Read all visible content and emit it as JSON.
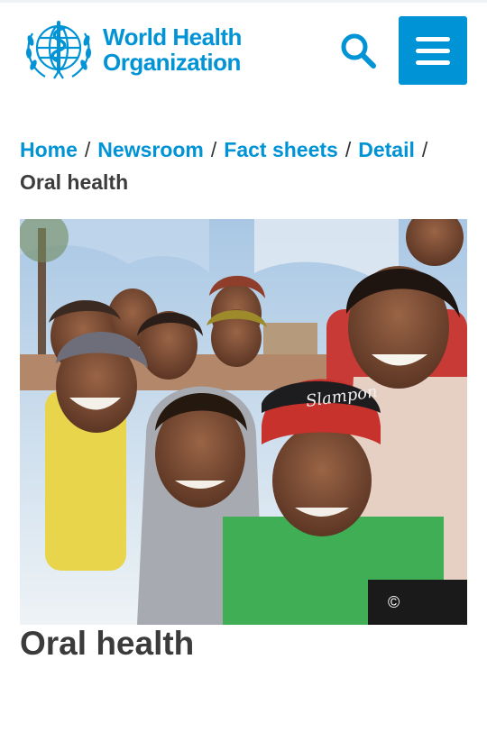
{
  "header": {
    "logo": {
      "line1": "World Health",
      "line2": "Organization"
    },
    "search_icon": "search-icon",
    "menu_icon": "hamburger-menu-icon"
  },
  "breadcrumb": {
    "items": [
      {
        "label": "Home"
      },
      {
        "label": "Newsroom"
      },
      {
        "label": "Fact sheets"
      },
      {
        "label": "Detail"
      }
    ],
    "separator": "/",
    "current": "Oral health"
  },
  "hero": {
    "cap_text": "Slampon",
    "copyright": "©"
  },
  "page": {
    "title": "Oral health"
  },
  "colors": {
    "brand": "#0093d5",
    "text": "#3b3b3b",
    "overlay": "#1a1a1a"
  }
}
